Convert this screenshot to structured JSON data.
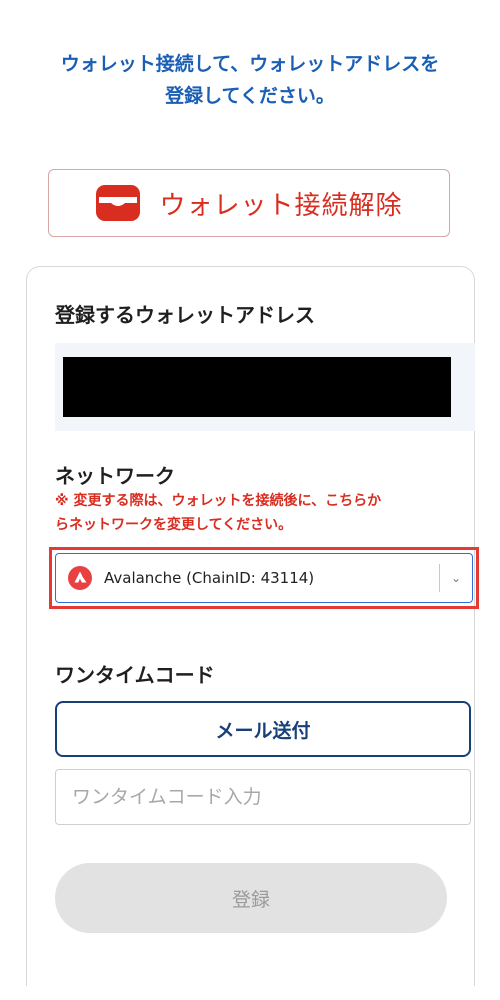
{
  "instruction": {
    "line1": "ウォレット接続して、ウォレットアドレスを",
    "line2": "登録してください。"
  },
  "disconnect_button": {
    "label": "ウォレット接続解除",
    "icon": "wallet-icon",
    "color": "#d92d20"
  },
  "address_section": {
    "title": "登録するウォレットアドレス",
    "value_redacted": true
  },
  "network_section": {
    "title": "ネットワーク",
    "note_line1": "※ 変更する際は、ウォレットを接続後に、こちらか",
    "note_line2": "らネットワークを変更してください。",
    "selected": "Avalanche (ChainID: 43114)",
    "icon": "avalanche-icon"
  },
  "otp_section": {
    "title": "ワンタイムコード",
    "send_button_label": "メール送付",
    "input_value": "",
    "input_placeholder": "ワンタイムコード入力"
  },
  "register_button": {
    "label": "登録",
    "disabled": true
  },
  "colors": {
    "accent_blue": "#1a5fb4",
    "error_red": "#d92d20",
    "navy": "#173f7a"
  }
}
